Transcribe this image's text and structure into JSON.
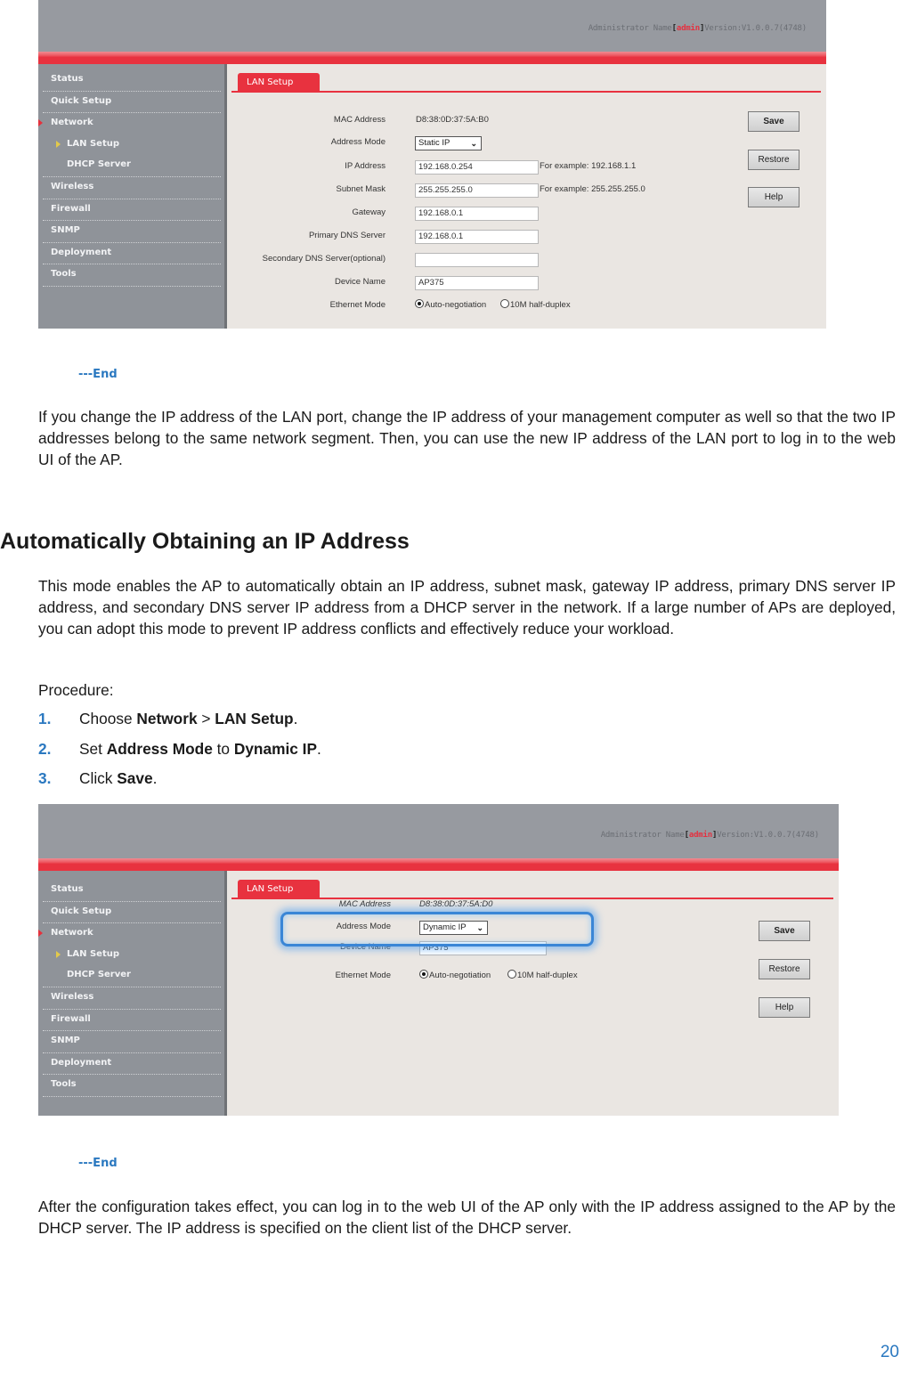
{
  "screenshot1": {
    "header": {
      "admin_prefix": "Administrator Name",
      "admin_name": "admin",
      "version": "Version:V1.0.0.7(4748)"
    },
    "sidebar": [
      {
        "label": "Status"
      },
      {
        "label": "Quick Setup"
      },
      {
        "label": "Network",
        "active": true
      },
      {
        "label": "LAN Setup",
        "sub": true,
        "active": true
      },
      {
        "label": "DHCP Server",
        "sub": true
      },
      {
        "label": "Wireless"
      },
      {
        "label": "Firewall"
      },
      {
        "label": "SNMP"
      },
      {
        "label": "Deployment"
      },
      {
        "label": "Tools"
      }
    ],
    "tab": "LAN Setup",
    "fields": {
      "mac_label": "MAC Address",
      "mac_value": "D8:38:0D:37:5A:B0",
      "mode_label": "Address Mode",
      "mode_value": "Static IP",
      "ip_label": "IP Address",
      "ip_value": "192.168.0.254",
      "ip_hint": "For example: 192.168.1.1",
      "mask_label": "Subnet Mask",
      "mask_value": "255.255.255.0",
      "mask_hint": "For example: 255.255.255.0",
      "gw_label": "Gateway",
      "gw_value": "192.168.0.1",
      "dns1_label": "Primary DNS Server",
      "dns1_value": "192.168.0.1",
      "dns2_label": "Secondary DNS Server(optional)",
      "dns2_value": "",
      "name_label": "Device Name",
      "name_value": "AP375",
      "eth_label": "Ethernet Mode",
      "eth_opt1": "Auto-negotiation",
      "eth_opt2": "10M half-duplex",
      "eth_selected": "Auto-negotiation"
    },
    "buttons": {
      "save": "Save",
      "restore": "Restore",
      "help": "Help"
    }
  },
  "end_marker_1": "---End",
  "para_1": "If you change the IP address of the LAN port, change the IP address of your management computer as well so that the two IP addresses belong to the same network segment. Then, you can use the new IP address of the LAN port to log in to the web UI of the AP.",
  "heading": "Automatically Obtaining an IP Address",
  "para_2": "This mode enables the AP to automatically obtain an IP address, subnet mask, gateway IP address, primary DNS server IP address, and secondary DNS server IP address from a DHCP server in the network. If a large number of APs are deployed, you can adopt this mode to prevent IP address conflicts and effectively reduce your workload.",
  "procedure_label": "Procedure:",
  "steps": [
    {
      "num": "1.",
      "pre": "Choose ",
      "b1": "Network",
      "mid": " > ",
      "b2": "LAN Setup",
      "post": "."
    },
    {
      "num": "2.",
      "pre": "Set ",
      "b1": "Address Mode",
      "mid": " to ",
      "b2": "Dynamic IP",
      "post": "."
    },
    {
      "num": "3.",
      "pre": "Click ",
      "b1": "Save",
      "mid": "",
      "b2": "",
      "post": "."
    }
  ],
  "screenshot2": {
    "header": {
      "admin_prefix": "Administrator Name",
      "admin_name": "admin",
      "version": "Version:V1.0.0.7(4748)"
    },
    "tab": "LAN Setup",
    "fields": {
      "mac_label": "MAC Address",
      "mac_value": "D8:38:0D:37:5A:D0",
      "mode_label": "Address Mode",
      "mode_value": "Dynamic IP",
      "name_label": "Device Name",
      "name_value": "AP375",
      "eth_label": "Ethernet Mode",
      "eth_opt1": "Auto-negotiation",
      "eth_opt2": "10M half-duplex",
      "eth_selected": "Auto-negotiation"
    },
    "buttons": {
      "save": "Save",
      "restore": "Restore",
      "help": "Help"
    },
    "highlight_color": "#3a86d6"
  },
  "end_marker_2": "---End",
  "para_3": "After the configuration takes effect, you can log in to the web UI of the AP only with the IP address assigned to the AP by the DHCP server. The IP address is specified on the client list of the DHCP server.",
  "page_number": "20",
  "colors": {
    "accent_red": "#e8323f",
    "accent_blue": "#2a78c0",
    "sidebar_gray": "#8f9399",
    "header_gray": "#979aa0"
  }
}
